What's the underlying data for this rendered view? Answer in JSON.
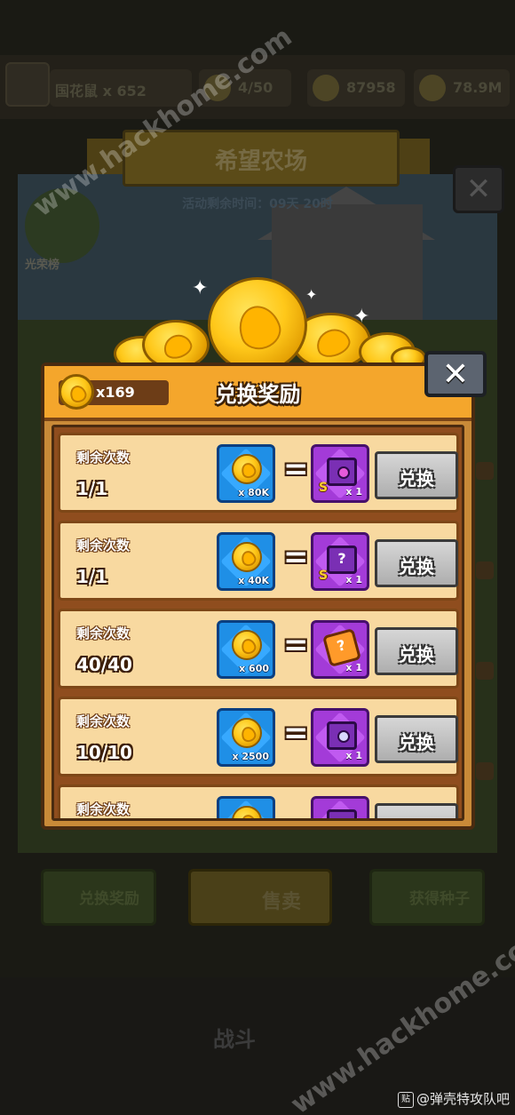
{
  "background": {
    "farm_title": "希望农场",
    "event_timer": "活动剩余时间：09天 20时",
    "glory_label": "光荣榜",
    "player_name": "国花鼠 x 652",
    "resources": [
      "4/50",
      "87958",
      "78.9M"
    ],
    "bottom_buttons": [
      "兑换奖励",
      "售卖",
      "获得种子"
    ],
    "battle_label": "战斗",
    "close_label": "✕"
  },
  "watermarks": [
    "www.hackhome.com",
    "www.hackhome.com"
  ],
  "credit": {
    "tag": "贴",
    "text": "@弹壳特攻队吧"
  },
  "dialog": {
    "title": "兑换奖励",
    "balance": "x169",
    "close_label": "✕",
    "button_label": "兑换",
    "remaining_label": "剩余次数",
    "rows": [
      {
        "remaining": "1/1",
        "cost": "x 80K",
        "reward_type": "s-rank-chest",
        "reward_badge": "S",
        "reward_qty": "x 1"
      },
      {
        "remaining": "1/1",
        "cost": "x 40K",
        "reward_type": "s-rank-mystery-chest",
        "reward_badge": "S",
        "reward_qty": "x 1"
      },
      {
        "remaining": "40/40",
        "cost": "x 600",
        "reward_type": "mystery-puzzle",
        "reward_badge": "",
        "reward_qty": "x 1"
      },
      {
        "remaining": "10/10",
        "cost": "x 2500",
        "reward_type": "chest",
        "reward_badge": "",
        "reward_qty": "x 1"
      },
      {
        "remaining": "",
        "cost": "",
        "reward_type": "chest",
        "reward_badge": "",
        "reward_qty": ""
      }
    ]
  },
  "colors": {
    "header": "#f4a62c",
    "row_bg": "#f8d9a0",
    "cost_tile": "#1f8fe6",
    "reward_tile": "#a33bd8"
  }
}
